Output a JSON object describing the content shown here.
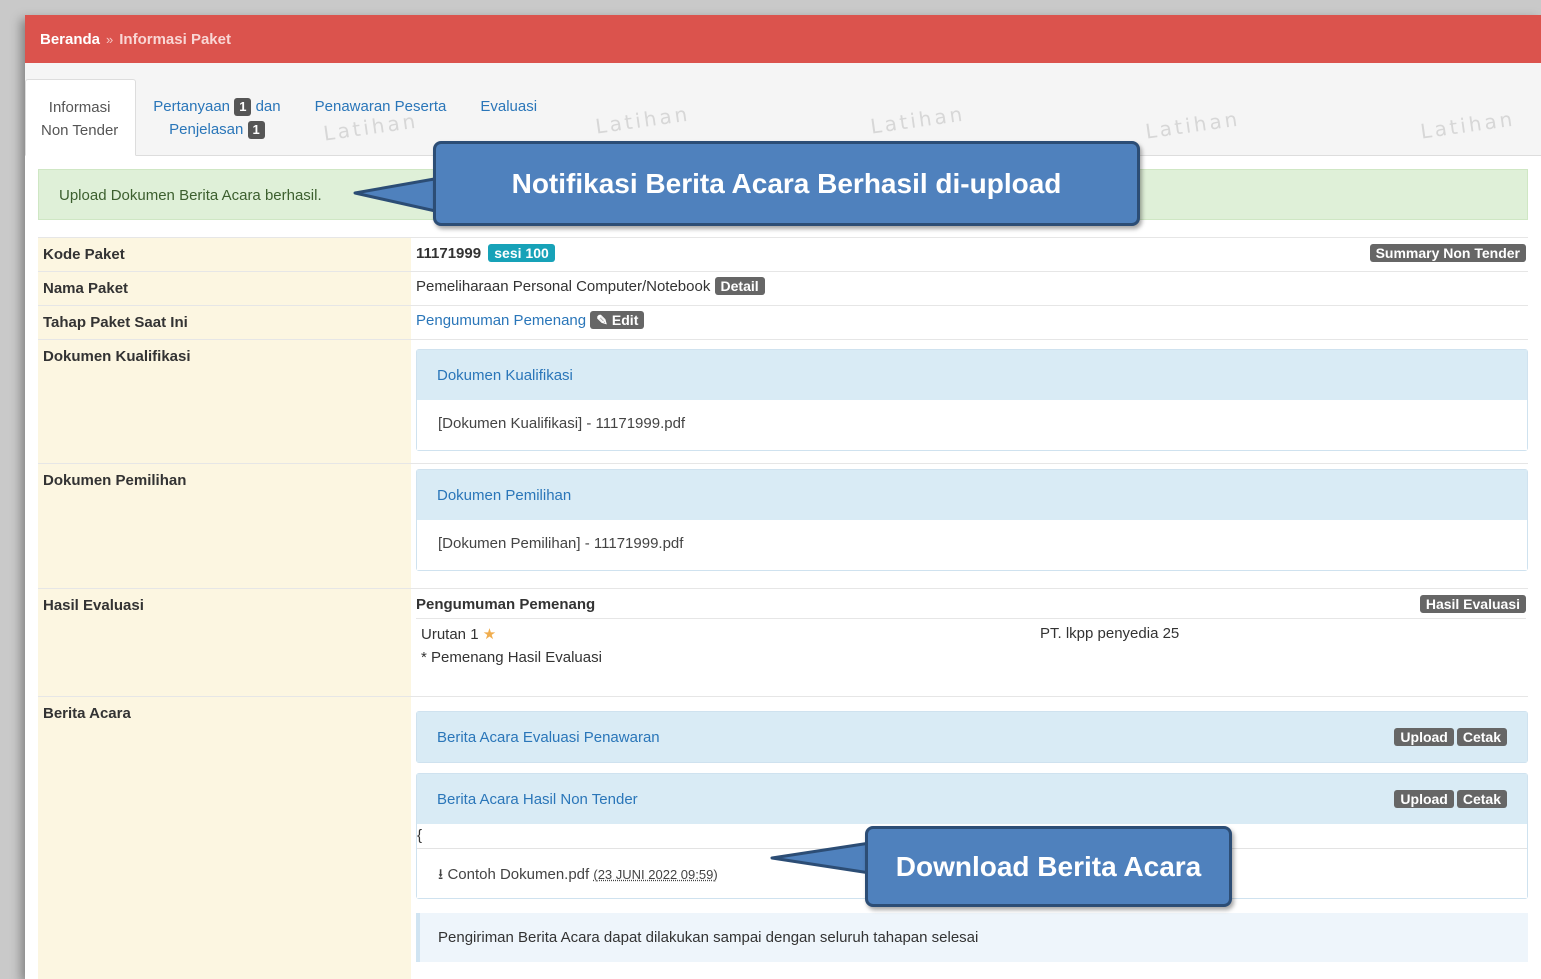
{
  "breadcrumb": {
    "home": "Beranda",
    "separator": "»",
    "current": "Informasi Paket"
  },
  "tabs": [
    {
      "line1": "Informasi",
      "line2": "Non Tender"
    },
    {
      "line1_a": "Pertanyaan",
      "badge1": "1",
      "line1_b": "dan",
      "line2": "Penjelasan",
      "badge2": "1"
    },
    {
      "label": "Penawaran Peserta"
    },
    {
      "label": "Evaluasi"
    }
  ],
  "watermark": "Latihan",
  "alert": "Upload Dokumen Berita Acara berhasil.",
  "rows": {
    "kode": {
      "label": "Kode Paket",
      "value": "11171999",
      "sesi": "sesi 100",
      "button": "Summary Non Tender"
    },
    "nama": {
      "label": "Nama Paket",
      "value": "Pemeliharaan Personal Computer/Notebook",
      "button": "Detail"
    },
    "tahap": {
      "label": "Tahap Paket Saat Ini",
      "value": "Pengumuman Pemenang",
      "button": "Edit"
    },
    "kualifikasi": {
      "label": "Dokumen Kualifikasi",
      "panel_title": "Dokumen Kualifikasi",
      "file": "[Dokumen Kualifikasi] - 11171999.pdf"
    },
    "pemilihan": {
      "label": "Dokumen Pemilihan",
      "panel_title": "Dokumen Pemilihan",
      "file": "[Dokumen Pemilihan] - 11171999.pdf"
    },
    "evaluasi": {
      "label": "Hasil Evaluasi",
      "title": "Pengumuman Pemenang",
      "button": "Hasil Evaluasi",
      "urutan": "Urutan 1",
      "peserta": "PT. lkpp penyedia 25",
      "note": "* Pemenang Hasil Evaluasi"
    },
    "berita": {
      "label": "Berita Acara",
      "panel1": "Berita Acara Evaluasi Penawaran",
      "panel2": "Berita Acara Hasil Non Tender",
      "upload": "Upload",
      "cetak": "Cetak",
      "brace": "{",
      "file": "Contoh Dokumen.pdf",
      "file_date": "(23 JUNI 2022 09:59)",
      "info": "Pengiriman Berita Acara dapat dilakukan sampai dengan seluruh tahapan selesai"
    }
  },
  "callouts": {
    "notif": "Notifikasi Berita Acara Berhasil di-upload",
    "download": "Download Berita Acara"
  },
  "colors": {
    "topbar": "#db534d",
    "link": "#2a76b9",
    "label_bg": "#fcf6e1",
    "callout": "#4f81bd"
  }
}
